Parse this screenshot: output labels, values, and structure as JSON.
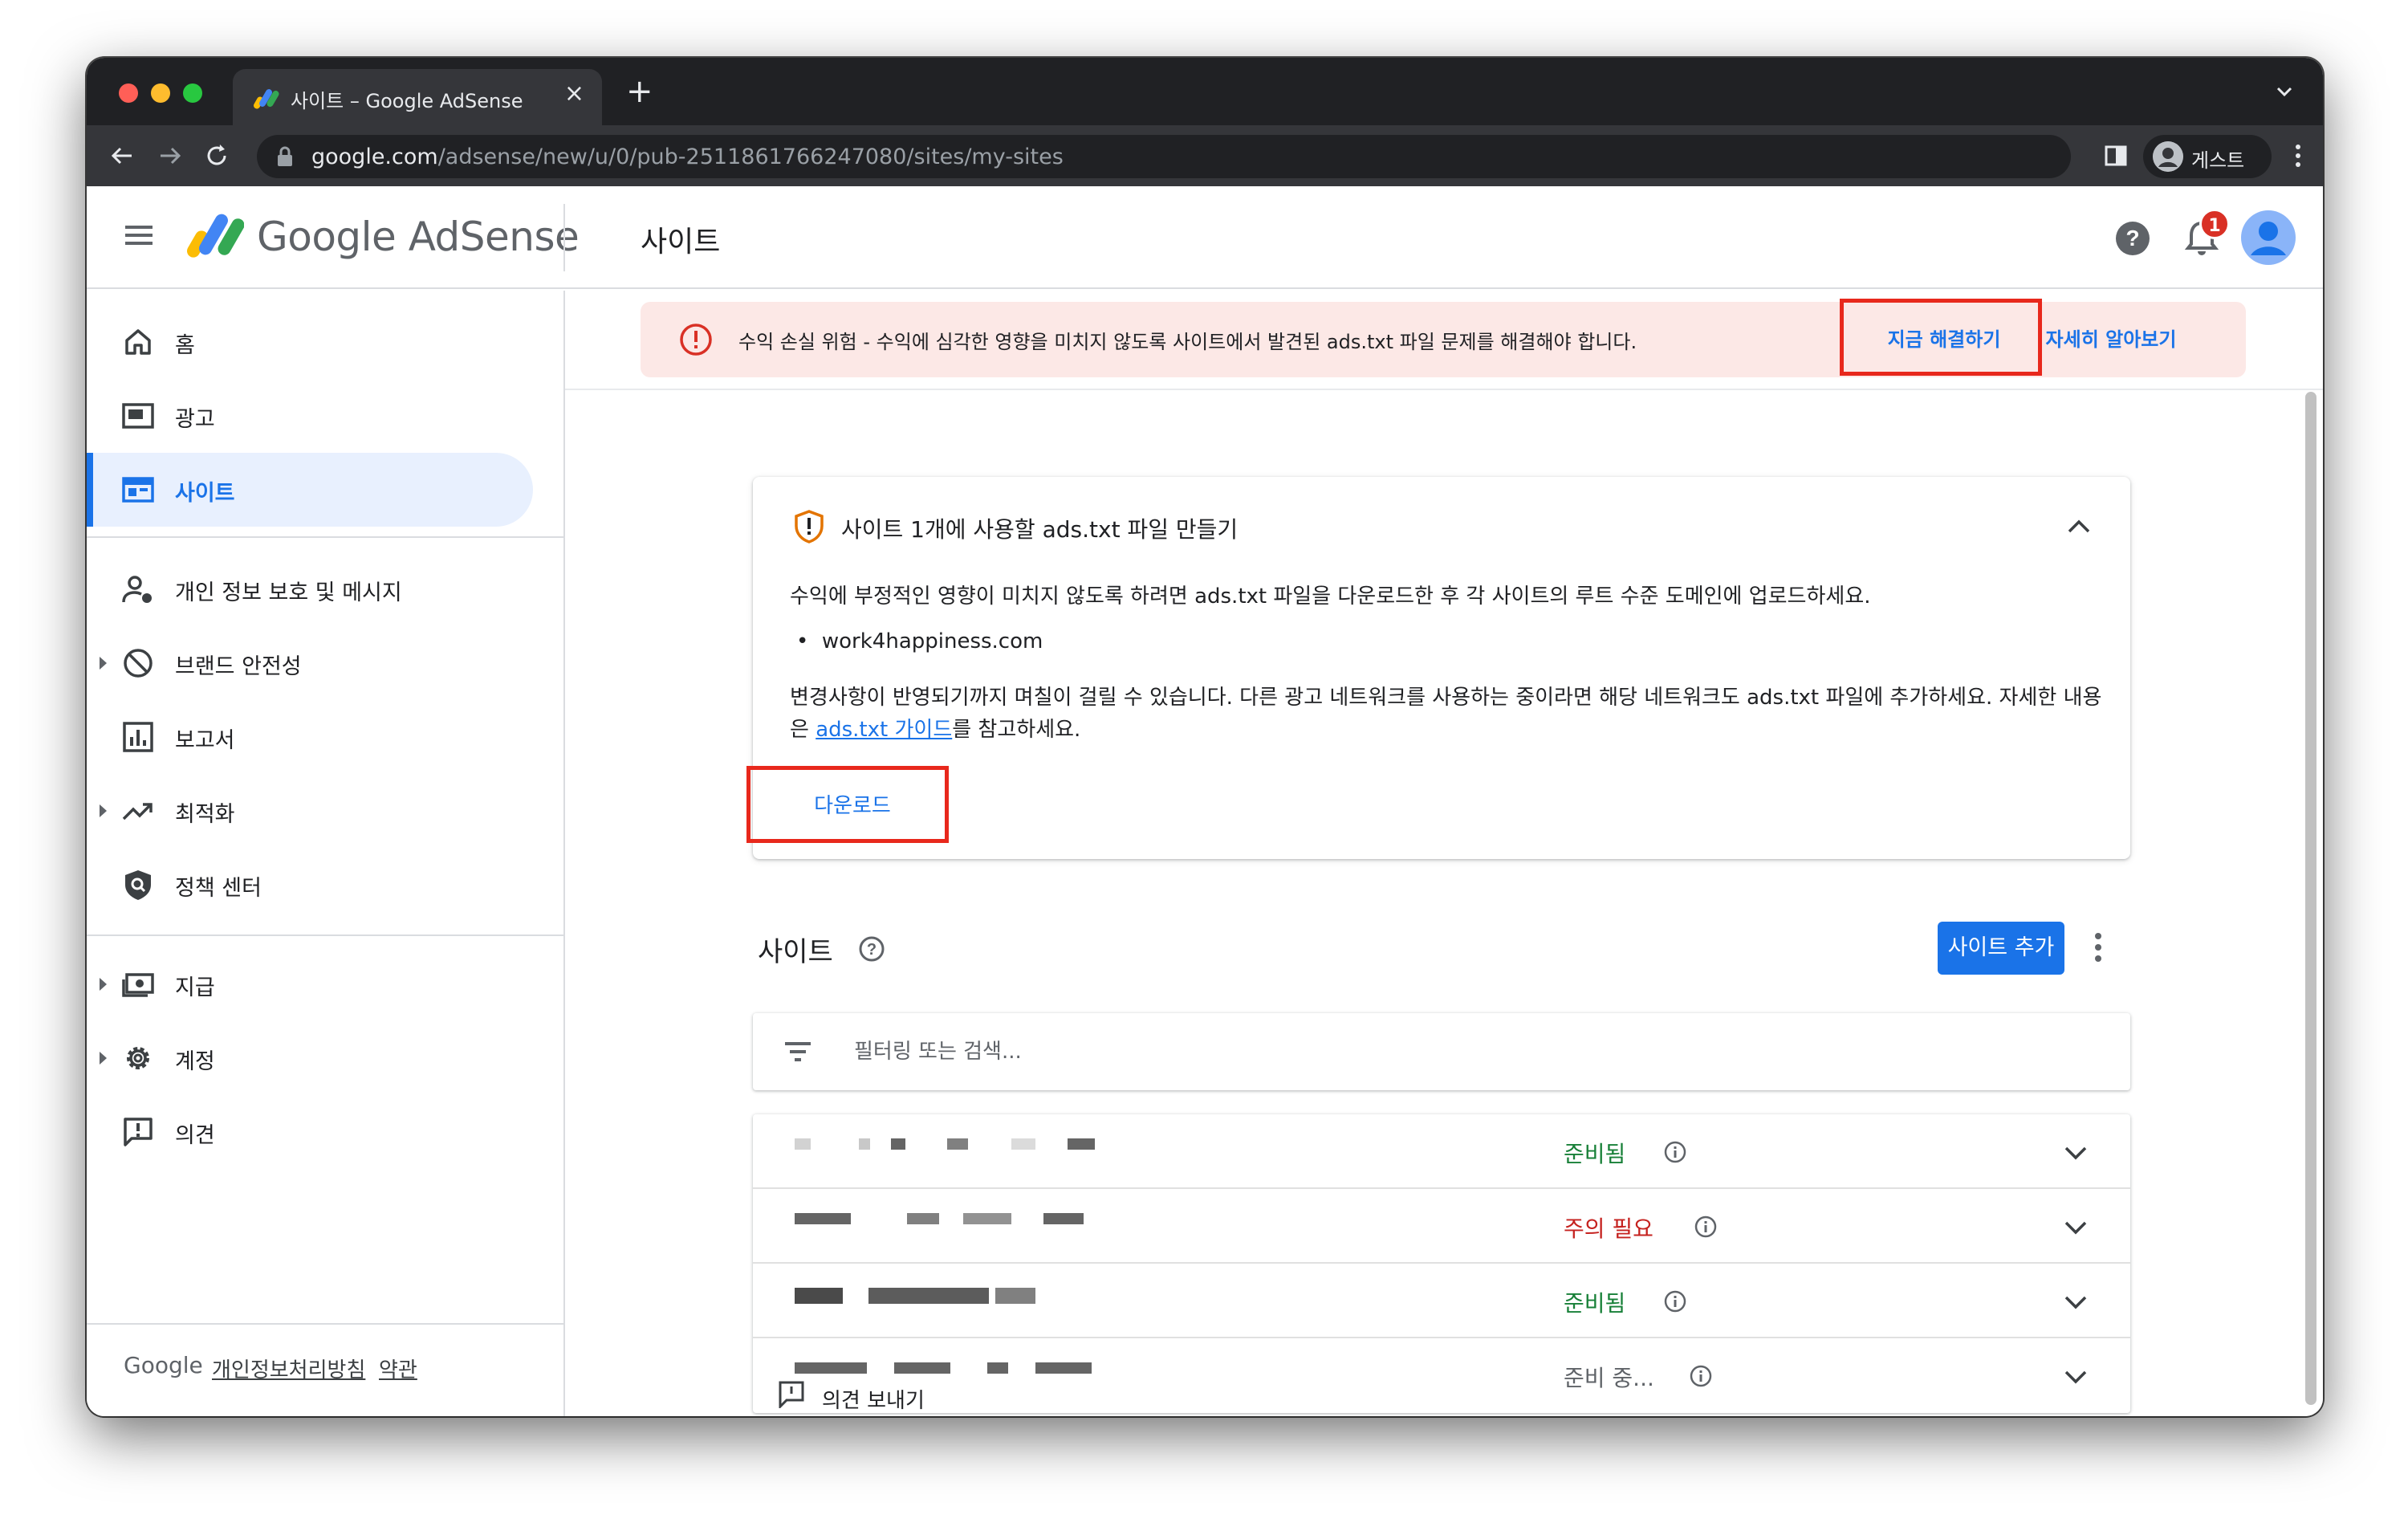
{
  "browser": {
    "tab_title": "사이트 – Google AdSense",
    "tab_close": "×",
    "new_tab": "+",
    "url_host": "google.com",
    "url_path": "/adsense/new/u/0/pub-2511861766247080/sites/my-sites",
    "profile_name": "게스트"
  },
  "header": {
    "logo_text": "Google AdSense",
    "page_title": "사이트",
    "notification_count": "1"
  },
  "sidebar": {
    "items": [
      {
        "label": "홈"
      },
      {
        "label": "광고"
      },
      {
        "label": "사이트"
      },
      {
        "label": "개인 정보 보호 및 메시지"
      },
      {
        "label": "브랜드 안전성"
      },
      {
        "label": "보고서"
      },
      {
        "label": "최적화"
      },
      {
        "label": "정책 센터"
      },
      {
        "label": "지급"
      },
      {
        "label": "계정"
      },
      {
        "label": "의견"
      }
    ],
    "footer": {
      "google": "Google",
      "privacy": "개인정보처리방침",
      "terms": "약관"
    }
  },
  "alert": {
    "text": "수익 손실 위험 - 수익에 심각한 영향을 미치지 않도록 사이트에서 발견된 ads.txt 파일 문제를 해결해야 합니다.",
    "fix_now": "지금 해결하기",
    "learn_more": "자세히 알아보기"
  },
  "ads_card": {
    "title": "사이트 1개에 사용할 ads.txt 파일 만들기",
    "intro": "수익에 부정적인 영향이 미치지 않도록 하려면 ads.txt 파일을 다운로드한 후 각 사이트의 루트 수준 도메인에 업로드하세요.",
    "bullet_mark": "•",
    "site": "work4happiness.com",
    "note_line1": "변경사항이 반영되기까지 며칠이 걸릴 수 있습니다. 다른 광고 네트워크를 사용하는 중이라면 해당 네트워크도 ads.txt 파일에 추가하세요. 자세한 내용",
    "note_pre": "은 ",
    "note_link": "ads.txt 가이드",
    "note_post": "를 참고하세요.",
    "download": "다운로드"
  },
  "sites": {
    "title": "사이트",
    "add_button": "사이트 추가",
    "filter_placeholder": "필터링 또는 검색...",
    "rows": [
      {
        "status": "준비됨",
        "status_color": "#188038"
      },
      {
        "status": "주의 필요",
        "status_color": "#c5221f"
      },
      {
        "status": "준비됨",
        "status_color": "#188038"
      },
      {
        "status": "준비 중...",
        "status_color": "#5f6368"
      }
    ]
  },
  "feedback": {
    "label": "의견 보내기"
  },
  "colors": {
    "accent": "#1a73e8",
    "alert_bg": "#fce8e6",
    "highlight": "#e8281c"
  }
}
